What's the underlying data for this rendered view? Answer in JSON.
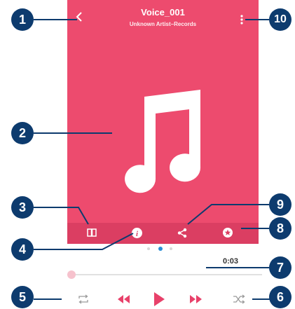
{
  "player": {
    "track_title": "Voice_001",
    "track_subtitle": "Unknown Artist–Records",
    "elapsed_time": "0:03",
    "progress_fraction": 0.02,
    "page_indicator": {
      "count": 3,
      "active_index": 1
    },
    "accent_color": "#ed4b6e",
    "control_color": "#e8416a"
  },
  "callouts": [
    {
      "number": "1"
    },
    {
      "number": "2"
    },
    {
      "number": "3"
    },
    {
      "number": "4"
    },
    {
      "number": "5"
    },
    {
      "number": "6"
    },
    {
      "number": "7"
    },
    {
      "number": "8"
    },
    {
      "number": "9"
    },
    {
      "number": "10"
    }
  ],
  "icons": {
    "back": "back-arrow-icon",
    "more": "more-vertical-icon",
    "art": "music-note-icon",
    "library": "book-icon",
    "info": "info-icon",
    "share": "share-icon",
    "favorite": "star-circle-icon",
    "repeat": "repeat-icon",
    "previous": "rewind-icon",
    "play": "play-icon",
    "next": "fast-forward-icon",
    "shuffle": "shuffle-icon"
  },
  "callout_color": "#0d3b6e"
}
